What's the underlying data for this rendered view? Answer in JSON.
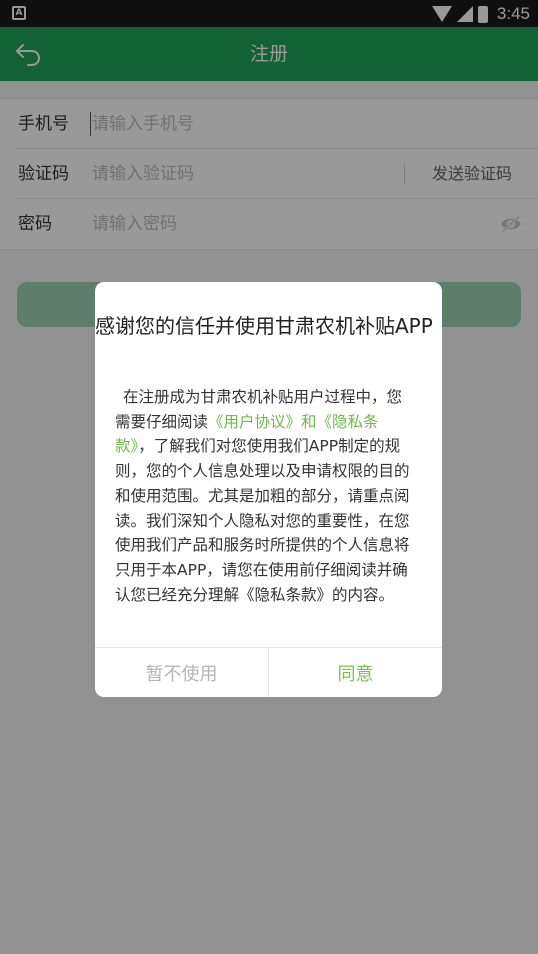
{
  "status_bar": {
    "time": "3:45",
    "left_icon_letter": "A"
  },
  "header": {
    "title": "注册",
    "back_icon": "back-arrow-icon"
  },
  "form": {
    "phone": {
      "label": "手机号",
      "placeholder": "请输入手机号"
    },
    "code": {
      "label": "验证码",
      "placeholder": "请输入验证码",
      "send_label": "发送验证码"
    },
    "password": {
      "label": "密码",
      "placeholder": "请输入密码",
      "toggle_icon": "eye-icon"
    }
  },
  "dialog": {
    "title": "感谢您的信任并使用甘肃农机补贴APP",
    "body_part1": "在注册成为甘肃农机补贴用户过程中，您需要仔细阅读",
    "link_user_agreement": "《用户协议》",
    "and": "和",
    "link_privacy": "《隐私条款》",
    "body_part2": "，了解我们对您使用我们APP制定的规则，您的个人信息处理以及申请权限的目的和使用范围。尤其是加粗的部分，请重点阅读。我们深知个人隐私对您的重要性，在您使用我们产品和服务时所提供的个人信息将只用于本APP，请您在使用前仔细阅读并确认您已经充分理解《隐私条款》的内容。",
    "cancel_label": "暂不使用",
    "agree_label": "同意"
  },
  "colors": {
    "primary": "#1fa35b",
    "link": "#6dbb4a",
    "agree": "#7cc04b"
  }
}
